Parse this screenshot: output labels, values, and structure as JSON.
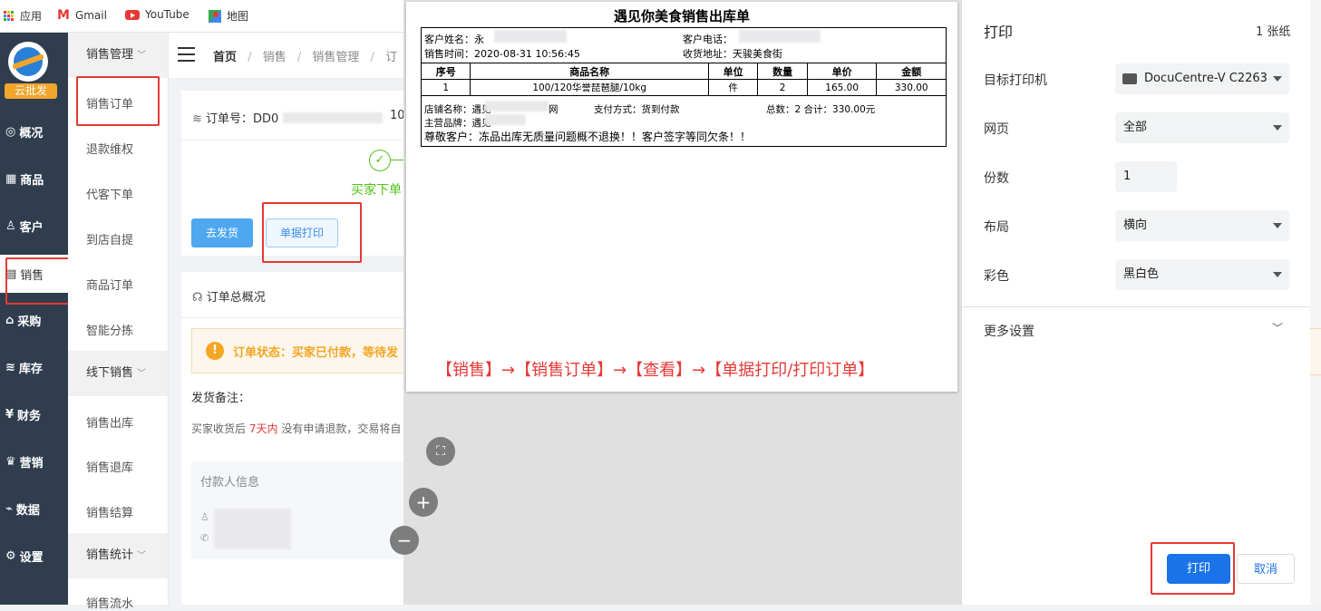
{
  "bookmarks": {
    "apps": "应用",
    "gmail": "Gmail",
    "youtube": "YouTube",
    "maps": "地图"
  },
  "left_nav": {
    "brand": "云批发",
    "items": [
      "概况",
      "商品",
      "客户",
      "销售",
      "采购",
      "库存",
      "财务",
      "营销",
      "数据",
      "设置"
    ]
  },
  "sub_nav": {
    "group1": "销售管理",
    "group1_items": [
      "销售订单",
      "退款维权",
      "代客下单",
      "到店自提",
      "商品订单",
      "智能分拣"
    ],
    "group2": "线下销售",
    "group2_items": [
      "销售出库",
      "销售退库",
      "销售结算"
    ],
    "group3": "销售统计",
    "group3_items": [
      "销售流水"
    ]
  },
  "breadcrumb": {
    "home": "首页",
    "sep": "/",
    "b1": "销售",
    "b2": "销售管理",
    "b3": "订"
  },
  "order": {
    "id_label": "订单号：DD0",
    "id_tail": "10",
    "step_label": "买家下单",
    "ship_button": "去发货",
    "print_button": "单据打印",
    "overview_title": "订单总概况",
    "status_text": "订单状态：买家已付款，等待发",
    "ship_note": "发货备注：",
    "refund_pre": "买家收货后",
    "refund_days": "7天内",
    "refund_post": "没有申请退款，交易将自",
    "payer_title": "付款人信息"
  },
  "receipt": {
    "title": "遇见你美食销售出库单",
    "customer_name_label": "客户姓名：永",
    "customer_phone_label": "客户电话：",
    "sale_time": "销售时间：2020-08-31 10:56:45",
    "address": "收货地址：天骏美食街",
    "headers": [
      "序号",
      "商品名称",
      "单位",
      "数量",
      "单价",
      "金额"
    ],
    "rows": [
      [
        "1",
        "100/120华誉琵琶腿/10kg",
        "件",
        "2",
        "165.00",
        "330.00"
      ]
    ],
    "shop_name": "店铺名称：遇见",
    "shop_name_tail": "网",
    "payment": "支付方式：货到付款",
    "total": "总数：2 合计：330.00元",
    "brand": "主营品牌：遇见",
    "notice": "尊敬客户：冻品出库无质量问题概不退换！！客户签字等同欠条！！",
    "instruction": "【销售】→【销售订单】→【查看】→【单据打印/打印订单】"
  },
  "print_panel": {
    "title": "打印",
    "sheets": "1 张纸",
    "printer_label": "目标打印机",
    "printer_value": "DocuCentre-V C2263",
    "pages_label": "网页",
    "pages_value": "全部",
    "copies_label": "份数",
    "copies_value": "1",
    "layout_label": "布局",
    "layout_value": "横向",
    "color_label": "彩色",
    "color_value": "黑白色",
    "more_settings": "更多设置",
    "print_button": "打印",
    "cancel_button": "取消"
  },
  "colors": {
    "accent_blue": "#1a73e8",
    "highlight_red": "#e53935",
    "nav_dark": "#2f3d4e",
    "success_green": "#52c41a",
    "warning_orange": "#f5a623"
  }
}
